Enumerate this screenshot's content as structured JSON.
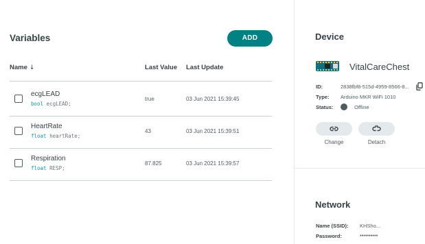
{
  "variables": {
    "title": "Variables",
    "add_label": "ADD",
    "columns": {
      "name": "Name",
      "sort_arrow": "↓",
      "last_value": "Last Value",
      "last_update": "Last Update"
    },
    "rows": [
      {
        "name": "ecgLEAD",
        "type": "bool",
        "decl_name": "ecgLEAD;",
        "value": "true",
        "updated": "03 Jun 2021 15:39:45"
      },
      {
        "name": "HeartRate",
        "type": "float",
        "decl_name": "heartRate;",
        "value": "43",
        "updated": "03 Jun 2021 15:39:51"
      },
      {
        "name": "Respiration",
        "type": "float",
        "decl_name": "RESP;",
        "value": "87.825",
        "updated": "03 Jun 2021 15:39:57"
      }
    ]
  },
  "device": {
    "title": "Device",
    "name": "VitalCareChest",
    "id_label": "ID:",
    "id_value": "2838fbf8-515d-4959-8566-8...",
    "type_label": "Type:",
    "type_value": "Arduino MKR WiFi 1010",
    "status_label": "Status:",
    "status_value": "Offline",
    "status_color": "#4e5b61",
    "change_label": "Change",
    "detach_label": "Detach"
  },
  "network": {
    "title": "Network",
    "ssid_label": "Name (SSID):",
    "ssid_value": "KHSho...",
    "password_label": "Password:",
    "password_value": "••••••••••"
  },
  "colors": {
    "accent": "#008184",
    "text": "#374146",
    "keyword": "#0d9bb0"
  }
}
